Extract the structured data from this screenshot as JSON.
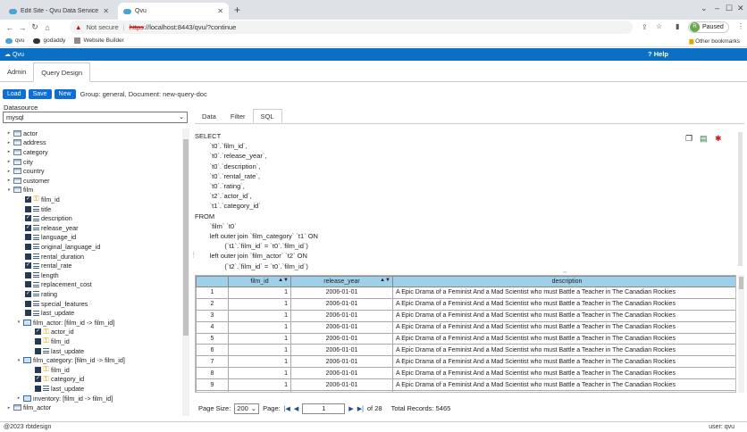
{
  "browser": {
    "tabs": [
      {
        "title": "Edit Site - Qvu Data Service",
        "active": false
      },
      {
        "title": "Qvu",
        "active": true
      }
    ],
    "not_secure": "Not secure",
    "url_scheme": "https",
    "url_rest": "://localhost:8443/qvu/?continue",
    "profile_initial": "R",
    "profile_status": "Paused",
    "bookmarks": [
      "qvu",
      "godaddy",
      "Website Builder"
    ],
    "other_bookmarks": "Other bookmarks"
  },
  "app": {
    "brand": "Qvu",
    "help": "Help",
    "tabs": [
      "Admin",
      "Query Design"
    ],
    "active_tab": "Query Design",
    "toolbar": {
      "load": "Load",
      "save": "Save",
      "new": "New",
      "info": "Group: general, Document: new-query-doc"
    }
  },
  "left": {
    "datasource_label": "Datasource",
    "datasource_value": "mysql"
  },
  "tree": [
    {
      "label": "actor",
      "kind": "table",
      "indent": 0,
      "toggle": "▸"
    },
    {
      "label": "address",
      "kind": "table",
      "indent": 0,
      "toggle": "▸"
    },
    {
      "label": "category",
      "kind": "table",
      "indent": 0,
      "toggle": "▸"
    },
    {
      "label": "city",
      "kind": "table",
      "indent": 0,
      "toggle": "▸"
    },
    {
      "label": "country",
      "kind": "table",
      "indent": 0,
      "toggle": "▸"
    },
    {
      "label": "customer",
      "kind": "table",
      "indent": 0,
      "toggle": "▸"
    },
    {
      "label": "film",
      "kind": "table",
      "indent": 0,
      "toggle": "▾"
    },
    {
      "label": "film_id",
      "kind": "field",
      "indent": 1,
      "checked": true,
      "pk": true
    },
    {
      "label": "title",
      "kind": "field",
      "indent": 1,
      "checked": false,
      "pk": false
    },
    {
      "label": "description",
      "kind": "field",
      "indent": 1,
      "checked": true,
      "pk": false
    },
    {
      "label": "release_year",
      "kind": "field",
      "indent": 1,
      "checked": true,
      "pk": false
    },
    {
      "label": "language_id",
      "kind": "field",
      "indent": 1,
      "checked": false,
      "pk": false
    },
    {
      "label": "original_language_id",
      "kind": "field",
      "indent": 1,
      "checked": false,
      "pk": false
    },
    {
      "label": "rental_duration",
      "kind": "field",
      "indent": 1,
      "checked": false,
      "pk": false
    },
    {
      "label": "rental_rate",
      "kind": "field",
      "indent": 1,
      "checked": true,
      "pk": false
    },
    {
      "label": "length",
      "kind": "field",
      "indent": 1,
      "checked": false,
      "pk": false
    },
    {
      "label": "replacement_cost",
      "kind": "field",
      "indent": 1,
      "checked": false,
      "pk": false
    },
    {
      "label": "rating",
      "kind": "field",
      "indent": 1,
      "checked": true,
      "pk": false
    },
    {
      "label": "special_features",
      "kind": "field",
      "indent": 1,
      "checked": false,
      "pk": false
    },
    {
      "label": "last_update",
      "kind": "field",
      "indent": 1,
      "checked": false,
      "pk": false
    },
    {
      "label": "film_actor: [film_id -> film_id]",
      "kind": "rel",
      "indent": 1,
      "toggle": "▾"
    },
    {
      "label": "actor_id",
      "kind": "field",
      "indent": 2,
      "checked": true,
      "pk": true
    },
    {
      "label": "film_id",
      "kind": "field",
      "indent": 2,
      "checked": false,
      "pk": true
    },
    {
      "label": "last_update",
      "kind": "field",
      "indent": 2,
      "checked": false,
      "pk": false
    },
    {
      "label": "film_category: [film_id -> film_id]",
      "kind": "rel",
      "indent": 1,
      "toggle": "▾"
    },
    {
      "label": "film_id",
      "kind": "field",
      "indent": 2,
      "checked": false,
      "pk": true
    },
    {
      "label": "category_id",
      "kind": "field",
      "indent": 2,
      "checked": true,
      "pk": true
    },
    {
      "label": "last_update",
      "kind": "field",
      "indent": 2,
      "checked": false,
      "pk": false
    },
    {
      "label": "inventory: [film_id -> film_id]",
      "kind": "rel",
      "indent": 1,
      "toggle": "▸"
    },
    {
      "label": "film_actor",
      "kind": "table",
      "indent": 0,
      "toggle": "▸"
    }
  ],
  "right": {
    "tabs": [
      "Data",
      "Filter",
      "SQL"
    ],
    "active_tab": "SQL",
    "sql": "SELECT\n        `t0`.`film_id`,\n        `t0`.`release_year`,\n        `t0`.`description`,\n        `t0`.`rental_rate`,\n        `t0`.`rating`,\n        `t2`.`actor_id`,\n        `t1`.`category_id`\nFROM\n        `film` `t0`\n        left outer join `film_category` `t1` ON\n                (`t1`.`film_id` = `t0`.`film_id`)\n        left outer join `film_actor` `t2` ON\n                (`t2`.`film_id` = `t0`.`film_id`)"
  },
  "grid": {
    "columns": [
      "",
      "film_id",
      "release_year",
      "description"
    ],
    "rows": [
      [
        "1",
        "1",
        "2006-01-01",
        "A Epic Drama of a Feminist And a Mad Scientist who must Battle a Teacher in The Canadian Rockies"
      ],
      [
        "2",
        "1",
        "2006-01-01",
        "A Epic Drama of a Feminist And a Mad Scientist who must Battle a Teacher in The Canadian Rockies"
      ],
      [
        "3",
        "1",
        "2006-01-01",
        "A Epic Drama of a Feminist And a Mad Scientist who must Battle a Teacher in The Canadian Rockies"
      ],
      [
        "4",
        "1",
        "2006-01-01",
        "A Epic Drama of a Feminist And a Mad Scientist who must Battle a Teacher in The Canadian Rockies"
      ],
      [
        "5",
        "1",
        "2006-01-01",
        "A Epic Drama of a Feminist And a Mad Scientist who must Battle a Teacher in The Canadian Rockies"
      ],
      [
        "6",
        "1",
        "2006-01-01",
        "A Epic Drama of a Feminist And a Mad Scientist who must Battle a Teacher in The Canadian Rockies"
      ],
      [
        "7",
        "1",
        "2006-01-01",
        "A Epic Drama of a Feminist And a Mad Scientist who must Battle a Teacher in The Canadian Rockies"
      ],
      [
        "8",
        "1",
        "2006-01-01",
        "A Epic Drama of a Feminist And a Mad Scientist who must Battle a Teacher in The Canadian Rockies"
      ],
      [
        "9",
        "1",
        "2006-01-01",
        "A Epic Drama of a Feminist And a Mad Scientist who must Battle a Teacher in The Canadian Rockies"
      ],
      [
        "10",
        "1",
        "2006-01-01",
        "A Epic Drama of a Feminist And a Mad Scientist who must Battle a Teacher in The Canadian Rockies"
      ]
    ]
  },
  "pager": {
    "page_size_label": "Page Size:",
    "page_size": "200",
    "page_label": "Page:",
    "page": "1",
    "of_pages": "of 28",
    "total": "Total Records: 5465"
  },
  "footer": {
    "copyright": "@2023 rbtdesign",
    "user": "user: qvu"
  },
  "colors": {
    "app_header": "#0b6fc4",
    "button": "#0d6ed8",
    "grid_header": "#9fd0ea"
  }
}
